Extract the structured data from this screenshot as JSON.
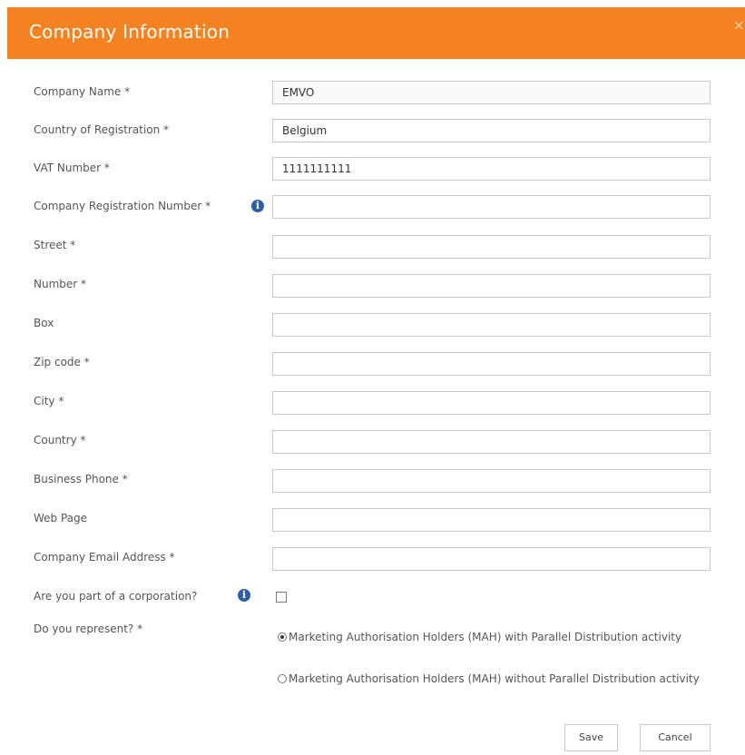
{
  "dialog": {
    "title": "Company Information",
    "close_glyph": "×"
  },
  "fields": {
    "company_name": {
      "label": "Company Name *",
      "value": "EMVO"
    },
    "country_of_registration": {
      "label": "Country of Registration *",
      "value": "Belgium"
    },
    "vat_number": {
      "label": "VAT Number *",
      "value": "1111111111"
    },
    "company_registration_number": {
      "label": "Company Registration Number *",
      "value": ""
    },
    "street": {
      "label": "Street *",
      "value": ""
    },
    "number": {
      "label": "Number *",
      "value": ""
    },
    "box": {
      "label": "Box",
      "value": ""
    },
    "zip_code": {
      "label": "Zip code *",
      "value": ""
    },
    "city": {
      "label": "City *",
      "value": ""
    },
    "country": {
      "label": "Country *",
      "value": ""
    },
    "business_phone": {
      "label": "Business Phone *",
      "value": ""
    },
    "web_page": {
      "label": "Web Page",
      "value": ""
    },
    "company_email": {
      "label": "Company Email Address *",
      "value": ""
    }
  },
  "corporation": {
    "label": "Are you part of a corporation?",
    "checked": false
  },
  "represent": {
    "label": "Do you represent? *",
    "options": [
      {
        "text": "Marketing Authorisation Holders (MAH) with Parallel Distribution activity",
        "selected": true
      },
      {
        "text": "Marketing Authorisation Holders (MAH) without Parallel Distribution activity",
        "selected": false
      }
    ]
  },
  "info_glyph": "i",
  "buttons": {
    "save": "Save",
    "cancel": "Cancel"
  },
  "colors": {
    "header": "#f58220",
    "info_icon": "#2e5ea8"
  }
}
